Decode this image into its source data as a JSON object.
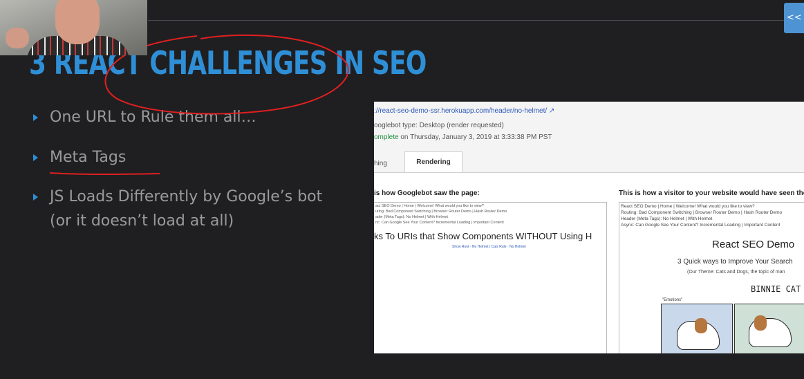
{
  "slide": {
    "title": "3 REACT CHALLENGES IN SEO",
    "bullets": [
      "One URL to Rule them all…",
      "Meta Tags",
      "JS Loads Differently by Google’s bot",
      "(or it doesn’t load at all)"
    ]
  },
  "toggle": {
    "label": "<<"
  },
  "screenshot": {
    "url": "://react-seo-demo-ssr.herokuapp.com/header/no-helmet/",
    "bot_type": "ooglebot type: Desktop (render requested)",
    "status_ok": "omplete",
    "status_rest": " on Thursday, January 3, 2019 at 3:33:38 PM PST",
    "tabs": [
      "hing",
      "Rendering"
    ],
    "left_heading": "is how Googlebot saw the page:",
    "right_heading": "This is how a visitor to your website would have seen the",
    "left_nav": [
      "act SEO Demo | Home | Welcome! What would you like to view?",
      "uting: Bad Component Switching | Browser Router Demo | Hash Router Demo",
      "ader (Meta Tags): No Helmet | With Helmet",
      "nc: Can Google See Your Content? Incremental Loading | Important Content"
    ],
    "left_big": "ks To URIs that Show Components WITHOUT Using H",
    "left_small": "Show Root · No Helmet | Cats Rule · No Helmet",
    "right_nav": [
      "React SEO Demo | Home | Welcome! What would you like to view?",
      "Routing: Bad Component Switching | Browser Router Demo | Hash Router Demo",
      "Header (Meta Tags): No Helmet | With Helmet",
      "Async: Can Google See Your Content? Incremental Loading | Important Content"
    ],
    "right_title": "React SEO Demo",
    "right_sub": "3 Quick ways to Improve Your Search",
    "right_theme": "(Our Theme: Cats and Dogs, the topic of man",
    "comic_title": "BINNIE CAT",
    "comic_caption": "\"Emotions\""
  },
  "colors": {
    "accent": "#2f8fd6",
    "annotation": "#e0201f",
    "background": "#1f1f22"
  }
}
